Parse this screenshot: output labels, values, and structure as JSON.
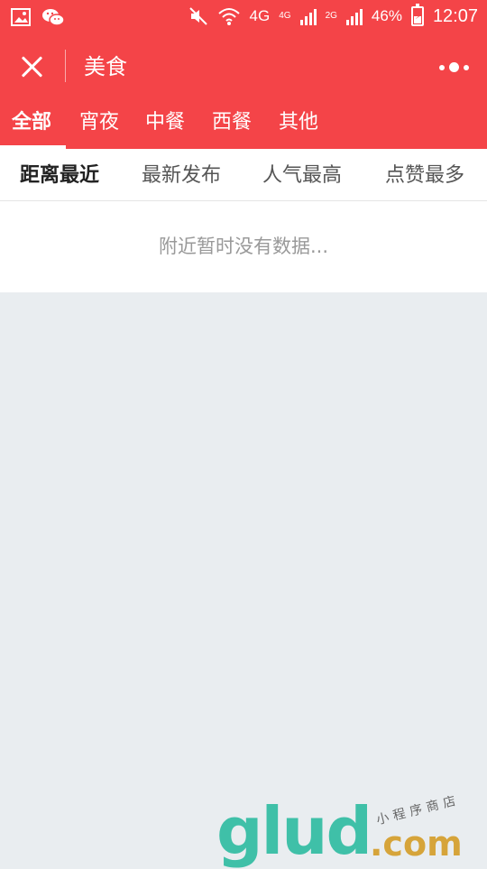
{
  "status_bar": {
    "network": "4G",
    "sim1": "4G",
    "sim2": "2G",
    "battery": "46%",
    "time": "12:07"
  },
  "header": {
    "title": "美食"
  },
  "category_tabs": [
    "全部",
    "宵夜",
    "中餐",
    "西餐",
    "其他"
  ],
  "sort_tabs": [
    "距离最近",
    "最新发布",
    "人气最高",
    "点赞最多"
  ],
  "empty_state": {
    "message": "附近暂时没有数据..."
  },
  "watermark": {
    "logo": "glud",
    "domain": ".com",
    "caption": "小程序商店"
  },
  "colors": {
    "brand": "#f44448",
    "background": "#e9edf0"
  }
}
